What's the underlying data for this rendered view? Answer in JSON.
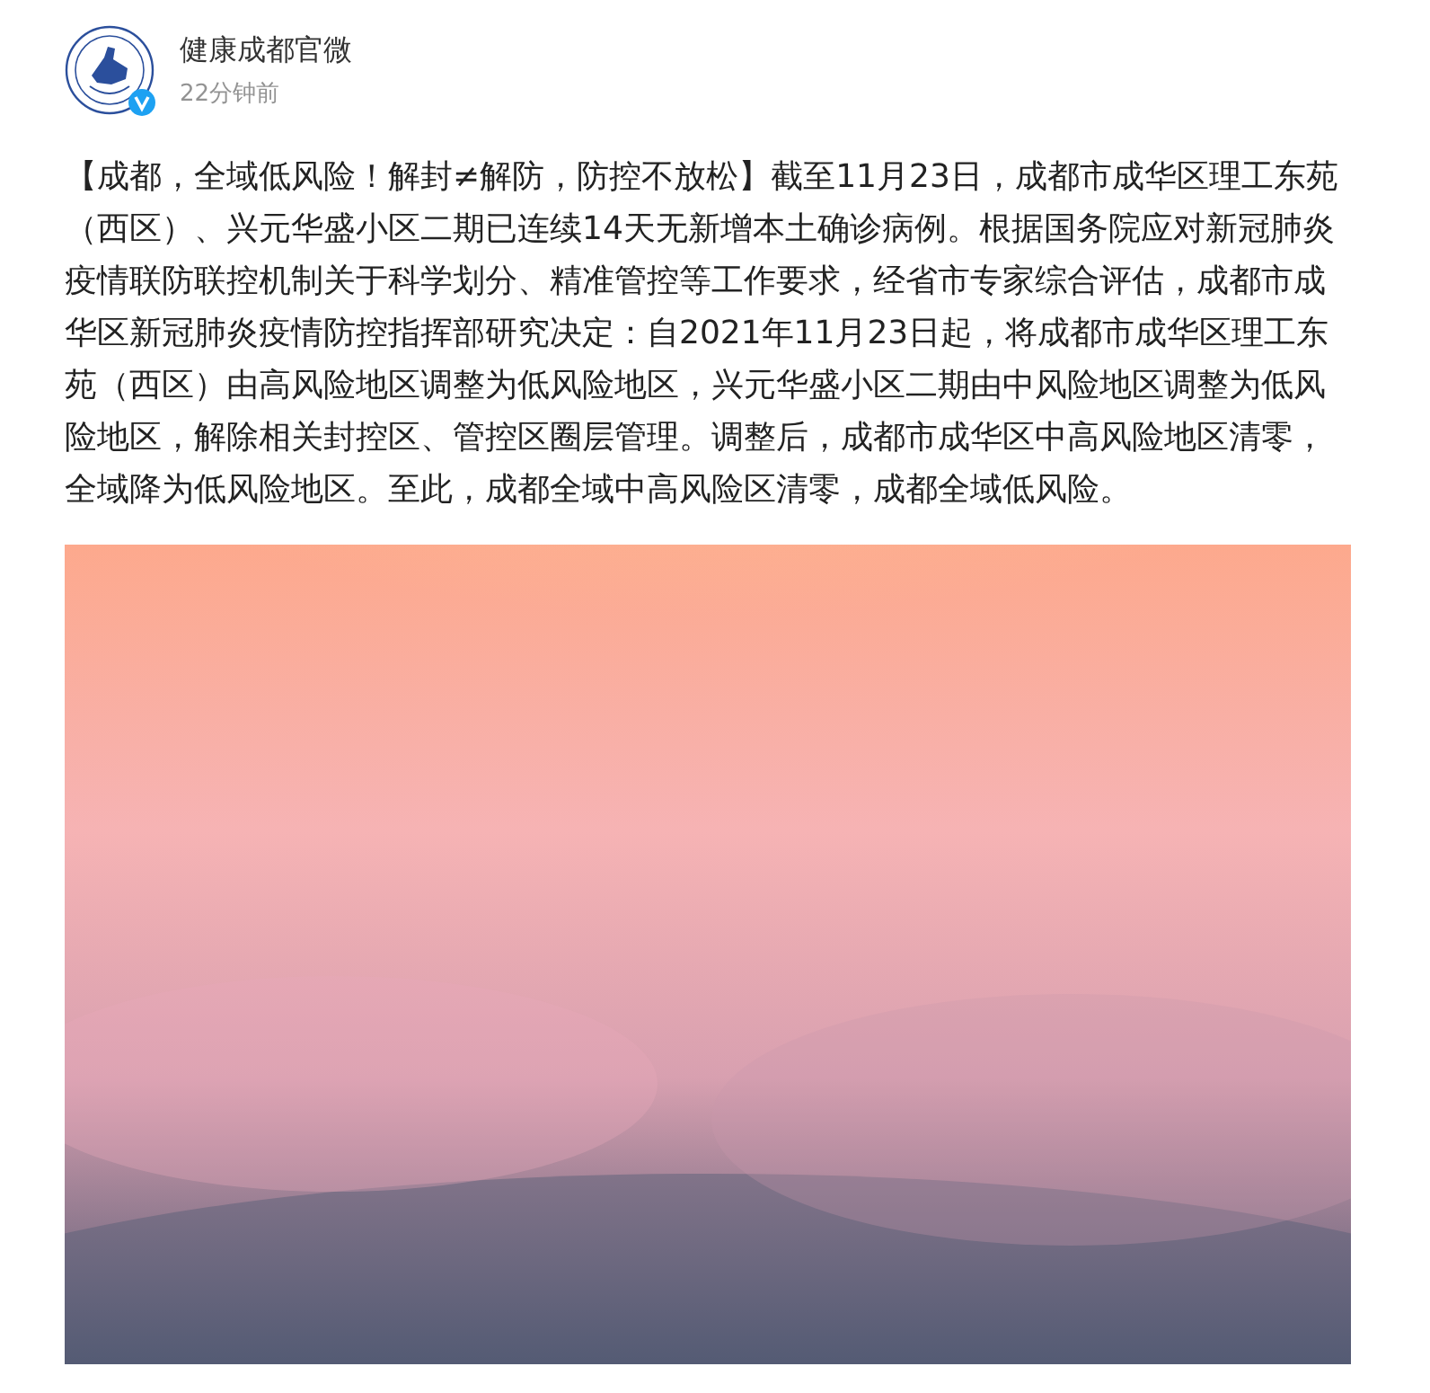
{
  "author": {
    "name": "健康成都官微",
    "time": "22分钟前",
    "verified": true
  },
  "post": {
    "text": "【成都，全域低风险！解封≠解防，防控不放松】截至11月23日，成都市成华区理工东苑（西区）、兴元华盛小区二期已连续14天无新增本土确诊病例。根据国务院应对新冠肺炎疫情联防联控机制关于科学划分、精准管控等工作要求，经省市专家综合评估，成都市成华区新冠肺炎疫情防控指挥部研究决定：自2021年11月23日起，将成都市成华区理工东苑（西区）由高风险地区调整为低风险地区，兴元华盛小区二期由中风险地区调整为低风险地区，解除相关封控区、管控区圈层管理。调整后，成都市成华区中高风险地区清零，全域降为低风险地区。至此，成都全域中高风险区清零，成都全域低风险。"
  }
}
